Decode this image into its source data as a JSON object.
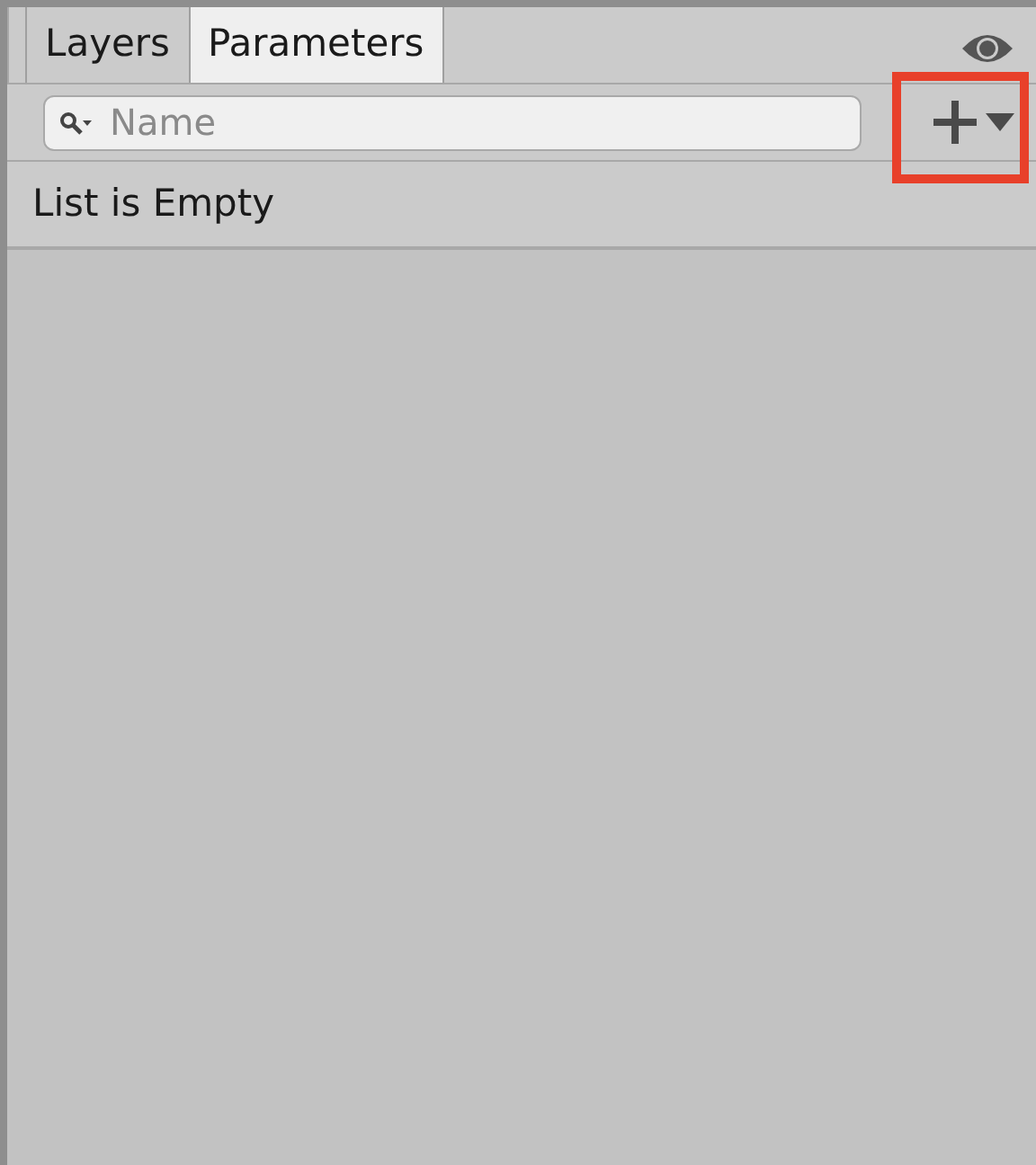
{
  "tabs": [
    {
      "label": "Layers",
      "selected": false
    },
    {
      "label": "Parameters",
      "selected": true
    }
  ],
  "search": {
    "placeholder": "Name"
  },
  "add_button": {
    "highlighted": true
  },
  "list": {
    "empty_message": "List is Empty"
  }
}
